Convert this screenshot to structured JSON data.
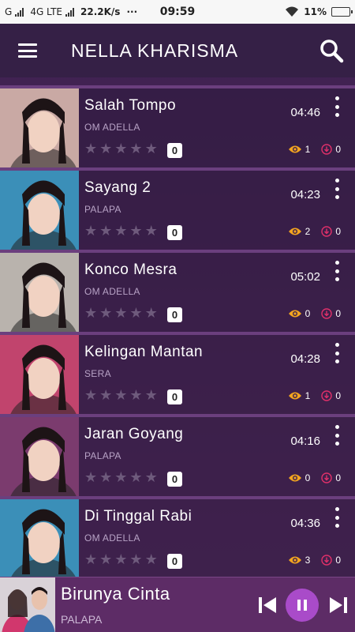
{
  "status_bar": {
    "carrier_left": "G",
    "network": "4G LTE",
    "speed": "22.2K/s",
    "dots": "···",
    "time": "09:59",
    "battery": "11%"
  },
  "app_bar": {
    "title": "NELLA KHARISMA",
    "menu_icon": "hamburger-menu-icon",
    "search_icon": "search-icon"
  },
  "songs": [
    {
      "title": "Salah Tompo",
      "artist": "OM ADELLA",
      "duration": "04:46",
      "rating": "0",
      "views": "1",
      "downloads": "0",
      "thumb_color": "#c9a9a4"
    },
    {
      "title": "Sayang 2",
      "artist": "PALAPA",
      "duration": "04:23",
      "rating": "0",
      "views": "2",
      "downloads": "0",
      "thumb_color": "#3b8fb8"
    },
    {
      "title": "Konco Mesra",
      "artist": "OM ADELLA",
      "duration": "05:02",
      "rating": "0",
      "views": "0",
      "downloads": "0",
      "thumb_color": "#b9b3ad"
    },
    {
      "title": "Kelingan Mantan",
      "artist": "SERA",
      "duration": "04:28",
      "rating": "0",
      "views": "1",
      "downloads": "0",
      "thumb_color": "#c1446d"
    },
    {
      "title": "Jaran Goyang",
      "artist": "PALAPA",
      "duration": "04:16",
      "rating": "0",
      "views": "0",
      "downloads": "0",
      "thumb_color": "#7b3b6e"
    },
    {
      "title": "Di Tinggal Rabi",
      "artist": "OM ADELLA",
      "duration": "04:36",
      "rating": "0",
      "views": "3",
      "downloads": "0",
      "thumb_color": "#3b8fb8"
    }
  ],
  "now_playing": {
    "title": "Birunya Cinta",
    "artist": "PALAPA",
    "prev_icon": "skip-previous-icon",
    "pause_icon": "pause-icon",
    "next_icon": "skip-next-icon"
  },
  "colors": {
    "accent": "#a94bc9",
    "views_icon": "#f2a41f",
    "downloads_icon": "#e0306a"
  }
}
